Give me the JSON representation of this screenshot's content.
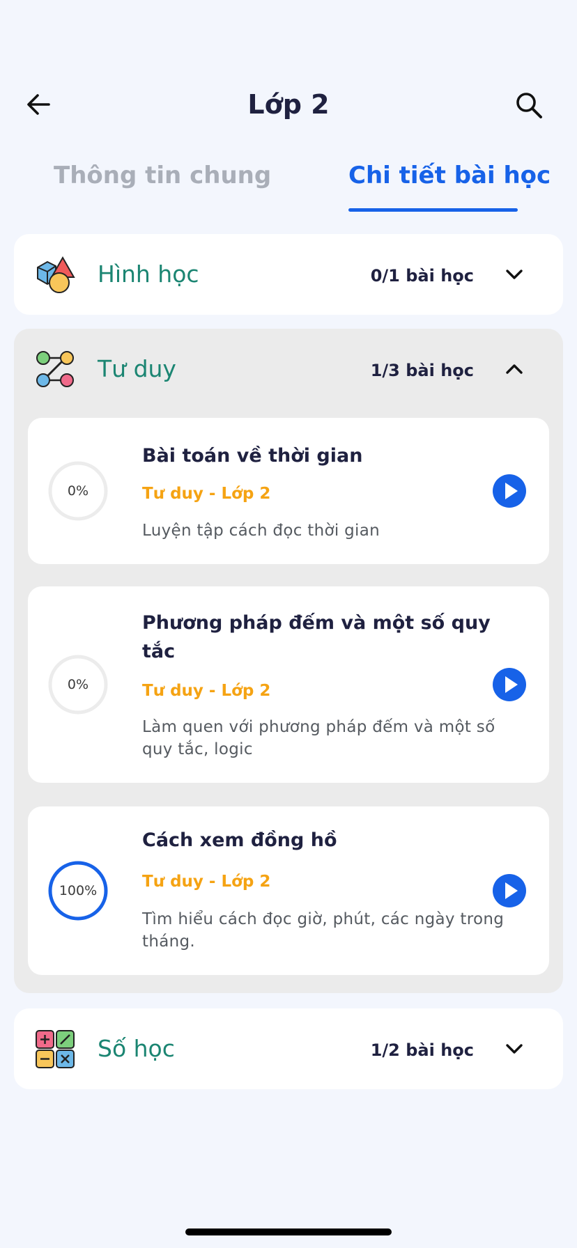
{
  "header": {
    "title": "Lớp 2",
    "back_icon": "arrow-left-icon",
    "search_icon": "search-icon"
  },
  "tabs": [
    {
      "label": "Thông tin chung",
      "active": false
    },
    {
      "label": "Chi tiết bài học",
      "active": true
    }
  ],
  "sections": [
    {
      "title": "Hình học",
      "count": "0/1 bài học",
      "icon": "geometry-shapes-icon",
      "expanded": false
    },
    {
      "title": "Tư duy",
      "count": "1/3 bài học",
      "icon": "logic-nodes-icon",
      "expanded": true,
      "lessons": [
        {
          "title": "Bài toán về thời gian",
          "subtitle": "Tư duy - Lớp 2",
          "description": "Luyện tập cách đọc thời gian",
          "progress_label": "0%",
          "progress": 0
        },
        {
          "title": "Phương pháp đếm và một số quy tắc",
          "subtitle": "Tư duy - Lớp 2",
          "description": "Làm quen với phương pháp đếm và một số quy tắc, logic",
          "progress_label": "0%",
          "progress": 0
        },
        {
          "title": "Cách xem đồng hồ",
          "subtitle": "Tư duy - Lớp 2",
          "description": "Tìm hiểu cách đọc giờ, phút, các ngày trong tháng.",
          "progress_label": "100%",
          "progress": 1
        }
      ]
    },
    {
      "title": "Số học",
      "count": "1/2 bài học",
      "icon": "calculator-operations-icon",
      "expanded": false
    }
  ],
  "colors": {
    "accent": "#1762e8",
    "section_title": "#1b8572",
    "lesson_subtitle": "#f5a313",
    "inactive_tab": "#a9aeb8"
  }
}
